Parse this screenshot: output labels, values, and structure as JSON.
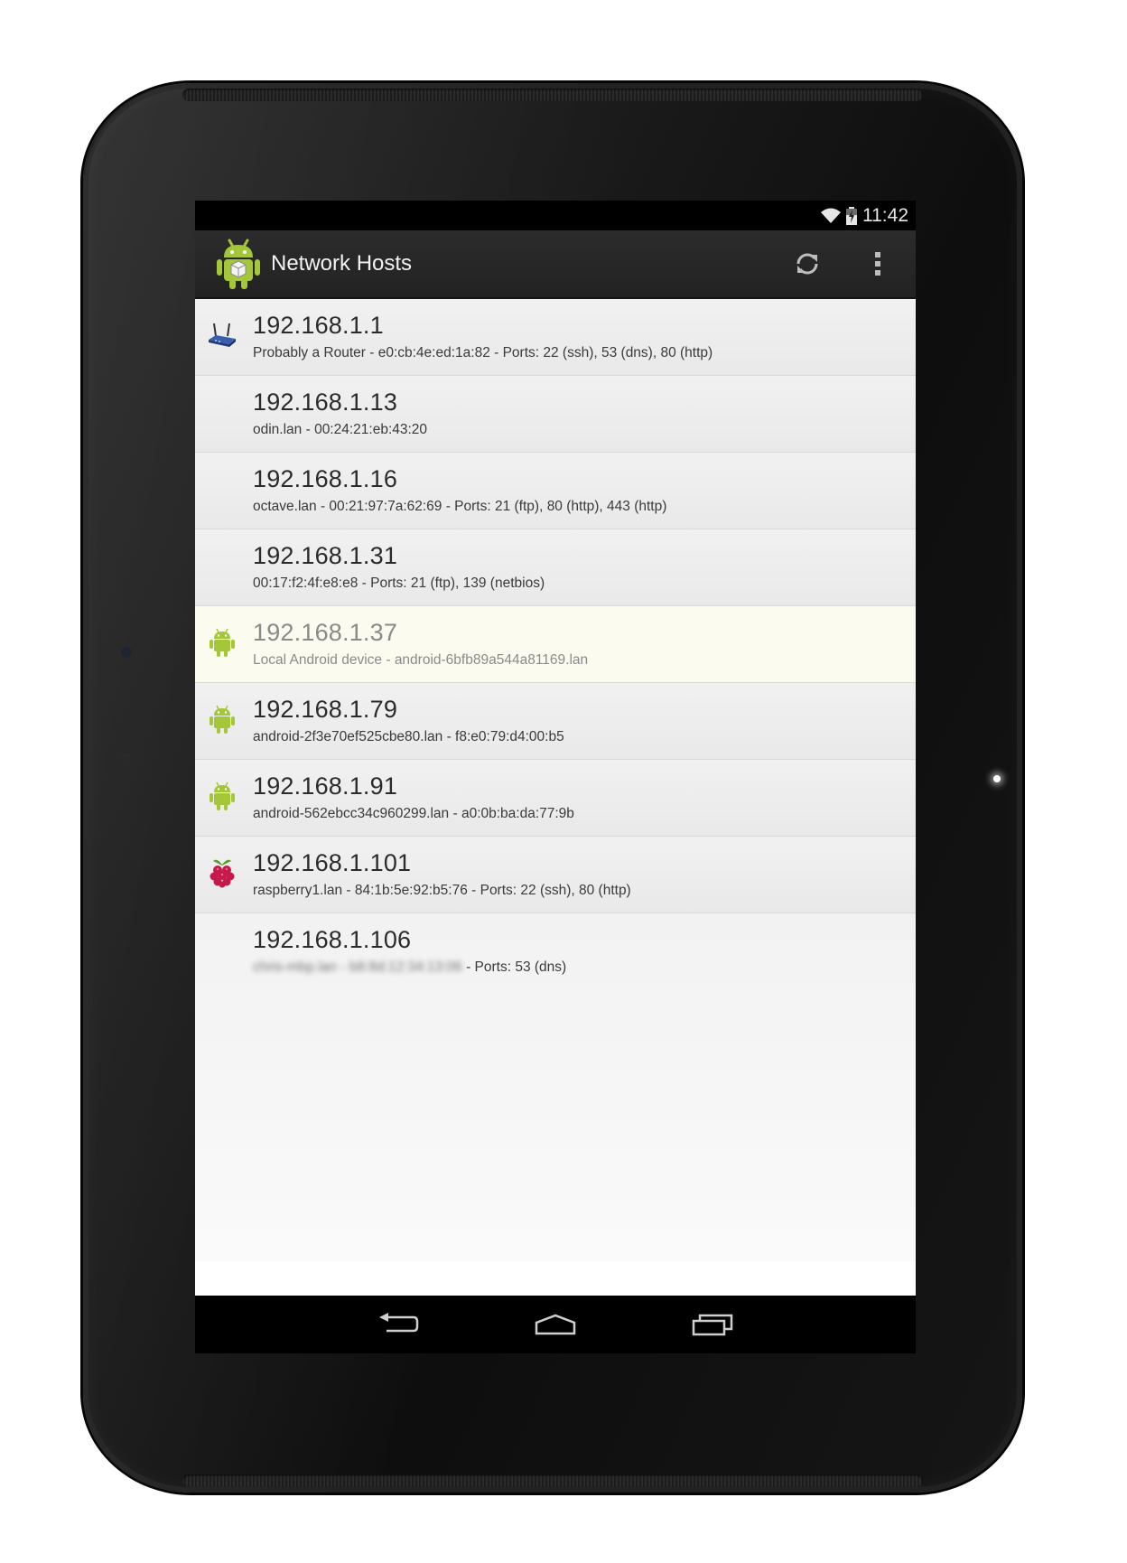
{
  "status_bar": {
    "time": "11:42",
    "wifi_icon": "wifi-icon",
    "battery_icon": "battery-icon"
  },
  "action_bar": {
    "title": "Network Hosts",
    "app_icon": "android-app-icon",
    "refresh_icon": "refresh-icon",
    "overflow_icon": "overflow-menu-icon"
  },
  "hosts": [
    {
      "ip": "192.168.1.1",
      "details": "Probably a Router - e0:cb:4e:ed:1a:82 - Ports: 22 (ssh), 53 (dns), 80 (http)",
      "icon": "router-icon"
    },
    {
      "ip": "192.168.1.13",
      "details": "odin.lan - 00:24:21:eb:43:20",
      "icon": ""
    },
    {
      "ip": "192.168.1.16",
      "details": "octave.lan - 00:21:97:7a:62:69 - Ports: 21 (ftp), 80 (http), 443 (http)",
      "icon": ""
    },
    {
      "ip": "192.168.1.31",
      "details": "00:17:f2:4f:e8:e8 - Ports: 21 (ftp), 139 (netbios)",
      "icon": ""
    },
    {
      "ip": "192.168.1.37",
      "details": "Local Android device - android-6bfb89a544a81169.lan",
      "icon": "android-icon",
      "local": true
    },
    {
      "ip": "192.168.1.79",
      "details": "android-2f3e70ef525cbe80.lan - f8:e0:79:d4:00:b5",
      "icon": "android-icon"
    },
    {
      "ip": "192.168.1.91",
      "details": "android-562ebcc34c960299.lan - a0:0b:ba:da:77:9b",
      "icon": "android-icon"
    },
    {
      "ip": "192.168.1.101",
      "details": "raspberry1.lan - 84:1b:5e:92:b5:76 - Ports: 22 (ssh), 80 (http)",
      "icon": "raspberry-pi-icon"
    },
    {
      "ip": "192.168.1.106",
      "details_blurred": "chris-mbp.lan - b8:8d:12:34:13:06",
      "details": " - Ports: 53 (dns)",
      "icon": ""
    }
  ],
  "nav_bar": {
    "back_icon": "back-icon",
    "home_icon": "home-icon",
    "recents_icon": "recents-icon"
  },
  "colors": {
    "android_green": "#a4c639",
    "action_bar": "#262626",
    "local_row": "#fbfbef"
  }
}
